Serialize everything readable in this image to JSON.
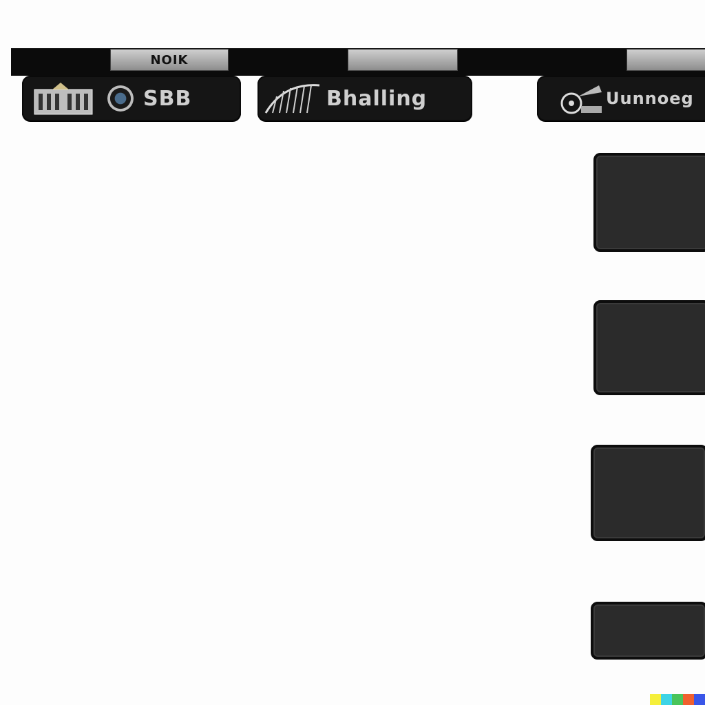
{
  "header": {
    "title_fragment": "NOIK",
    "chip_center": "",
    "chip_right": ""
  },
  "toolbar": {
    "panels": [
      {
        "label": "SBB",
        "icon": "building-icon"
      },
      {
        "label": "Bhalling",
        "icon": "harp-icon"
      },
      {
        "label": "Uunnoeg",
        "icon": "gramophone-icon"
      }
    ]
  },
  "side_buttons": [
    {
      "label": ""
    },
    {
      "label": ""
    },
    {
      "label": ""
    },
    {
      "label": ""
    }
  ],
  "color_strip": [
    "#f5ef3b",
    "#3ed4e6",
    "#49c45a",
    "#f0602e",
    "#3a56e8"
  ]
}
